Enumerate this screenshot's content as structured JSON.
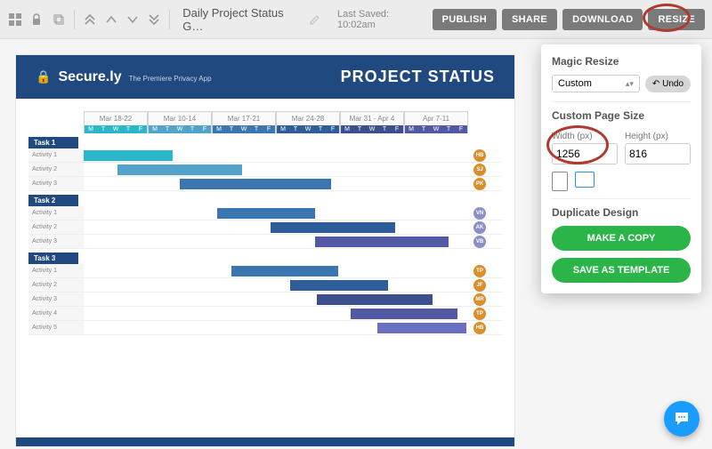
{
  "topbar": {
    "title": "Daily Project Status G…",
    "last_saved": "Last Saved: 10:02am",
    "buttons": {
      "publish": "PUBLISH",
      "share": "SHARE",
      "download": "DOWNLOAD",
      "resize": "RESIZE"
    }
  },
  "doc": {
    "brand_name": "Secure.ly",
    "brand_tag": "The Premiere Privacy App",
    "title": "PROJECT STATUS"
  },
  "weeks": [
    "Mar 18-22",
    "Mar 10-14",
    "Mar 17-21",
    "Mar 24-28",
    "Mar 31 - Apr 4",
    "Apr 7-11"
  ],
  "days": [
    "M",
    "T",
    "W",
    "T",
    "F"
  ],
  "sections": [
    {
      "name": "Task 1",
      "rows": [
        {
          "label": "Activity 1",
          "badge": "HB",
          "badge_color": "#d88f2d",
          "bar_start": 0,
          "bar_len": 100,
          "color": "#29b7c9"
        },
        {
          "label": "Activity 2",
          "badge": "SJ",
          "badge_color": "#d88f2d",
          "bar_start": 38,
          "bar_len": 140,
          "color": "#52a2ca"
        },
        {
          "label": "Activity 3",
          "badge": "PK",
          "badge_color": "#d88f2d",
          "bar_start": 108,
          "bar_len": 170,
          "color": "#3b76b1"
        }
      ]
    },
    {
      "name": "Task 2",
      "rows": [
        {
          "label": "Activity 1",
          "badge": "VN",
          "badge_color": "#8a90c9",
          "bar_start": 150,
          "bar_len": 110,
          "color": "#3b76b1"
        },
        {
          "label": "Activity 2",
          "badge": "AK",
          "badge_color": "#8a90c9",
          "bar_start": 210,
          "bar_len": 140,
          "color": "#2f5d99"
        },
        {
          "label": "Activity 3",
          "badge": "VB",
          "badge_color": "#8a90c9",
          "bar_start": 260,
          "bar_len": 150,
          "color": "#5358a4"
        }
      ]
    },
    {
      "name": "Task 3",
      "rows": [
        {
          "label": "Activity 1",
          "badge": "TP",
          "badge_color": "#d88f2d",
          "bar_start": 166,
          "bar_len": 120,
          "color": "#3b76b1"
        },
        {
          "label": "Activity 2",
          "badge": "JF",
          "badge_color": "#d88f2d",
          "bar_start": 232,
          "bar_len": 110,
          "color": "#2f5d99"
        },
        {
          "label": "Activity 3",
          "badge": "MR",
          "badge_color": "#d88f2d",
          "bar_start": 262,
          "bar_len": 130,
          "color": "#3c4f8c"
        },
        {
          "label": "Activity 4",
          "badge": "TP",
          "badge_color": "#d88f2d",
          "bar_start": 300,
          "bar_len": 120,
          "color": "#5358a4"
        },
        {
          "label": "Activity 5",
          "badge": "HB",
          "badge_color": "#d88f2d",
          "bar_start": 330,
          "bar_len": 100,
          "color": "#6a6fc1"
        }
      ]
    }
  ],
  "panel": {
    "magic_resize": "Magic Resize",
    "preset": "Custom",
    "undo": "Undo",
    "custom_size": "Custom Page Size",
    "width_label": "Width (px)",
    "height_label": "Height (px)",
    "width_value": "1256",
    "height_value": "816",
    "duplicate": "Duplicate Design",
    "make_copy": "MAKE A COPY",
    "save_tpl": "SAVE AS TEMPLATE"
  }
}
